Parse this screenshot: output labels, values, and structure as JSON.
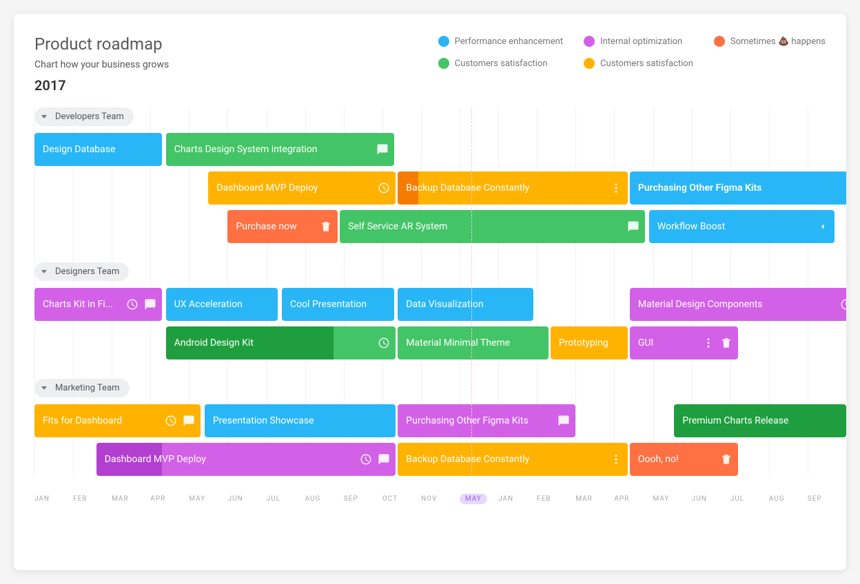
{
  "header": {
    "title": "Product roadmap",
    "subtitle": "Chart how your business grows",
    "year": "2017"
  },
  "legend": [
    {
      "label": "Performance enhancement",
      "color": "#29b6f6"
    },
    {
      "label": "Internal optimization",
      "color": "#d261e8"
    },
    {
      "label": "Sometimes 💩 happens",
      "color": "#ff7043"
    },
    {
      "label": "Customers satisfaction",
      "color": "#43c466"
    },
    {
      "label": "Customers satisfaction",
      "color": "#ffb300"
    }
  ],
  "months": [
    "JAN",
    "FEB",
    "MAR",
    "APR",
    "MAY",
    "JUN",
    "JUL",
    "AUG",
    "SEP",
    "OCT",
    "NOV",
    "MAY",
    "JAN",
    "FEB",
    "MAR",
    "APR",
    "MAY",
    "JUN",
    "JUL",
    "AUG",
    "SEP"
  ],
  "highlight_month_index": 11,
  "colors": {
    "blue": "#29b6f6",
    "green": "#43c466",
    "darkgreen": "#1e9e3e",
    "orange": "#ffb300",
    "darkorange": "#f57c00",
    "red": "#ff7043",
    "purple": "#d261e8",
    "darkpurple": "#b23fd0"
  },
  "chart_data": {
    "type": "gantt",
    "x_unit": "month_index",
    "x_range": [
      0,
      21
    ],
    "groups": [
      {
        "name": "Developers Team",
        "rows": [
          [
            {
              "label": "Design Database",
              "start": 0,
              "end": 3.3,
              "color": "blue"
            },
            {
              "label": "Charts Design System integration",
              "start": 3.4,
              "end": 9.3,
              "color": "green",
              "icons": [
                "chat"
              ]
            }
          ],
          [
            {
              "label": "Dashboard MVP Deploy",
              "start": 4.5,
              "end": 9.35,
              "color": "orange",
              "icons": [
                "clock"
              ]
            },
            {
              "label": "Backup Database Constantly",
              "start": 9.4,
              "end": 15.35,
              "color": "orange",
              "progress_color": "darkorange",
              "progress": 0.09,
              "icons": [
                "dots"
              ]
            },
            {
              "label": "Purchasing Other Figma Kits",
              "start": 15.4,
              "end": 21.3,
              "color": "blue",
              "bold": true
            }
          ],
          [
            {
              "label": "Purchase now",
              "start": 5.0,
              "end": 7.85,
              "color": "red",
              "icons": [
                "trash"
              ]
            },
            {
              "label": "Self Service AR System",
              "start": 7.9,
              "end": 15.8,
              "color": "green",
              "icons": [
                "chat"
              ]
            },
            {
              "label": "Workflow Boost",
              "start": 15.9,
              "end": 20.7,
              "color": "blue",
              "icons": [
                "caret-left"
              ]
            }
          ]
        ]
      },
      {
        "name": "Designers Team",
        "rows": [
          [
            {
              "label": "Charts Kit in Fi...",
              "start": 0,
              "end": 3.3,
              "color": "purple",
              "icons": [
                "clock",
                "chat"
              ]
            },
            {
              "label": "UX Acceleration",
              "start": 3.4,
              "end": 6.3,
              "color": "blue"
            },
            {
              "label": "Cool Presentation",
              "start": 6.4,
              "end": 9.3,
              "color": "blue"
            },
            {
              "label": "Data Visualization",
              "start": 9.4,
              "end": 12.9,
              "color": "blue"
            },
            {
              "label": "Material Design Components",
              "start": 15.4,
              "end": 21.3,
              "color": "purple",
              "icons": [
                "clock"
              ]
            }
          ],
          [
            {
              "label": "Android Design Kit",
              "start": 3.4,
              "end": 9.35,
              "color": "green",
              "progress_color": "darkgreen",
              "progress": 0.73,
              "icons": [
                "clock"
              ]
            },
            {
              "label": "Material Minimal Theme",
              "start": 9.4,
              "end": 13.3,
              "color": "green"
            },
            {
              "label": "Prototyping",
              "start": 13.35,
              "end": 15.35,
              "color": "orange"
            },
            {
              "label": "GUI",
              "start": 15.4,
              "end": 18.2,
              "color": "purple",
              "icons": [
                "dots",
                "trash"
              ]
            }
          ]
        ]
      },
      {
        "name": "Marketing Team",
        "rows": [
          [
            {
              "label": "Fits for Dashboard",
              "start": 0,
              "end": 4.3,
              "color": "orange",
              "icons": [
                "clock",
                "chat"
              ]
            },
            {
              "label": "Presentation Showcase",
              "start": 4.4,
              "end": 9.35,
              "color": "blue"
            },
            {
              "label": "Purchasing Other Figma Kits",
              "start": 9.4,
              "end": 14.0,
              "color": "purple",
              "icons": [
                "chat"
              ]
            },
            {
              "label": "Premium Charts Release",
              "start": 16.55,
              "end": 21.0,
              "color": "darkgreen"
            }
          ],
          [
            {
              "label": "Dashboard MVP Deploy",
              "start": 1.6,
              "end": 9.35,
              "color": "purple",
              "progress_color": "darkpurple",
              "progress": 0.22,
              "icons": [
                "clock",
                "chat"
              ]
            },
            {
              "label": "Backup Database Constantly",
              "start": 9.4,
              "end": 15.35,
              "color": "orange",
              "icons": [
                "dots"
              ]
            },
            {
              "label": "Oooh, no!",
              "start": 15.4,
              "end": 18.2,
              "color": "red",
              "icons": [
                "trash"
              ]
            }
          ]
        ]
      }
    ]
  }
}
